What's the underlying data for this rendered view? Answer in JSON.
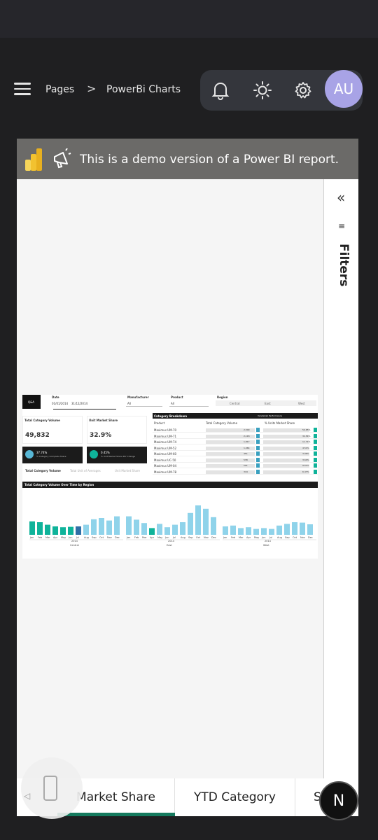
{
  "breadcrumb": {
    "pages": "Pages",
    "separator": ">",
    "current": "PowerBi Charts"
  },
  "header": {
    "avatar_initials": "AU",
    "icons": [
      "bell-icon",
      "sun-icon",
      "gear-icon"
    ]
  },
  "banner": {
    "text": "This is a demo version of a Power BI report."
  },
  "filters": {
    "title": "Filters",
    "collapse_glyph": "«"
  },
  "report": {
    "qa_label": "Q&A",
    "slicers": {
      "date_label": "Date",
      "date_from": "01/01/2014",
      "date_to": "31/12/2014",
      "manufacturer_label": "Manufacturer",
      "manufacturer_value": "All",
      "product_label": "Product",
      "product_value": "All",
      "region_label": "Region",
      "region_options": [
        "Central",
        "East",
        "West"
      ]
    },
    "kpis": {
      "volume_title": "Total Category Volume",
      "volume_value": "49,832",
      "share_title": "Unit Market Share",
      "share_value": "32.9%",
      "growth1_value": "37.74%",
      "growth1_label": "% Category Complete Share",
      "growth2_value": "0.45%",
      "growth2_label": "% Unit Market Share PLY Change"
    },
    "subtabs": [
      "Total Category Volume",
      "Total Unit of Averages",
      "Unit Market Share"
    ],
    "breakdown": {
      "title": "Category Breakdown",
      "legend": "Vanderlab Performance",
      "legend_items": [
        "Low",
        "Medium",
        "High"
      ],
      "col_product": "Product",
      "col_volume": "Total Category Volume",
      "col_share": "% Units Market Share",
      "rows": [
        {
          "product": "Maximus UM-70",
          "volume": "2,509",
          "share": "50.65%"
        },
        {
          "product": "Maximus UM-71",
          "volume": "2,118",
          "share": "32.54%"
        },
        {
          "product": "Maximus UM-74",
          "volume": "1,817",
          "share": "11.71%"
        },
        {
          "product": "Maximus UM-52",
          "volume": "1,064",
          "share": "4.51%"
        },
        {
          "product": "Maximus UM-60",
          "volume": "451",
          "share": "3.96%"
        },
        {
          "product": "Maximus UC-50",
          "volume": "538",
          "share": "3.60%"
        },
        {
          "product": "Maximus UM-04",
          "volume": "591",
          "share": "9.61%"
        },
        {
          "product": "Maximus UM-78",
          "volume": "344",
          "share": "6.47%"
        }
      ]
    },
    "chart_title": "Total Category Volume Over Time by Region",
    "months": [
      "Jan",
      "Feb",
      "Mar",
      "Apr",
      "May",
      "Jun",
      "Jul",
      "Aug",
      "Sep",
      "Oct",
      "Nov",
      "Dec"
    ],
    "year": "2014",
    "regions": [
      "Central",
      "East",
      "West"
    ]
  },
  "chart_data": {
    "type": "bar",
    "title": "Total Category Volume Over Time by Region",
    "groups": [
      "Central",
      "East",
      "West"
    ],
    "categories": [
      "Jan",
      "Feb",
      "Mar",
      "Apr",
      "May",
      "Jun",
      "Jul",
      "Aug",
      "Sep",
      "Oct",
      "Nov",
      "Dec"
    ],
    "series": [
      {
        "name": "Central",
        "values": [
          0.32,
          0.3,
          0.24,
          0.2,
          0.18,
          0.19,
          0.2,
          0.24,
          0.37,
          0.4,
          0.34,
          0.44
        ]
      },
      {
        "name": "East",
        "values": [
          0.44,
          0.36,
          0.28,
          0.16,
          0.26,
          0.18,
          0.24,
          0.3,
          0.52,
          0.7,
          0.62,
          0.42
        ]
      },
      {
        "name": "West",
        "values": [
          0.2,
          0.22,
          0.16,
          0.18,
          0.14,
          0.16,
          0.14,
          0.22,
          0.26,
          0.3,
          0.29,
          0.25
        ]
      }
    ],
    "highlight_colors": {
      "low": "#0fb39a",
      "medium": "#2f6fa6",
      "high": "#8fd3ea"
    }
  },
  "tabs": [
    {
      "label": "Market Share",
      "active": true
    },
    {
      "label": "YTD Category",
      "active": false
    },
    {
      "label": "S",
      "active": false
    }
  ],
  "fab": {
    "label": "N"
  }
}
